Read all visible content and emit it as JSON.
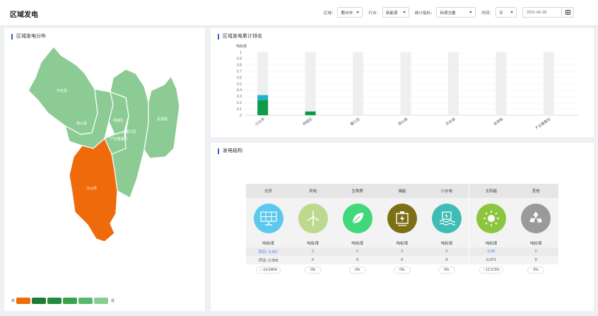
{
  "header": {
    "title": "区域发电",
    "filters": {
      "region_label": "区域：",
      "region_value": "衢州市",
      "industry_label": "行业：",
      "industry_value": "新能源",
      "metric_label": "统计指标：",
      "metric_value": "标煤当量",
      "time_label": "时间：",
      "time_unit_value": "日",
      "date_value": "2021-06-28"
    }
  },
  "map": {
    "title": "区域发电分布",
    "regions": [
      {
        "name": "开化县",
        "color": "#8ccc94"
      },
      {
        "name": "常山县",
        "color": "#8ccc94"
      },
      {
        "name": "柯城区",
        "color": "#8ccc94"
      },
      {
        "name": "衢江区",
        "color": "#8ccc94"
      },
      {
        "name": "产业集聚区",
        "color": "#8ccc94"
      },
      {
        "name": "龙游县",
        "color": "#8ccc94"
      },
      {
        "name": "江山市",
        "color": "#ef6a0b"
      }
    ],
    "legend": {
      "high": "高",
      "low": "低",
      "colors": [
        "#ef6a0b",
        "#1e7a35",
        "#248a3c",
        "#37a24c",
        "#5ab86e",
        "#8ccc94"
      ]
    }
  },
  "ranking": {
    "title": "区域发电累计排名",
    "chart_data": {
      "type": "bar",
      "ylabel": "吨标煤",
      "ylim": [
        0,
        1
      ],
      "yticks": [
        "1",
        "0.9",
        "0.8",
        "0.7",
        "0.6",
        "0.5",
        "0.4",
        "0.3",
        "0.2",
        "0.1",
        "0"
      ],
      "categories": [
        "江山市",
        "柯城区",
        "衢江区",
        "常山县",
        "开化县",
        "龙游县",
        "产业集聚区"
      ],
      "series": [
        {
          "color": "#0f9b48",
          "values": [
            0.24,
            0.06,
            0,
            0,
            0,
            0,
            0
          ]
        },
        {
          "color": "#1fb3c9",
          "values": [
            0.08,
            0,
            0,
            0,
            0,
            0,
            0
          ]
        }
      ],
      "background_bar": "#efefef",
      "grid": true
    }
  },
  "structure": {
    "title": "发电结构",
    "columns": [
      {
        "name": "光伏",
        "icon": "solar-panel-icon",
        "color": "#5bc8ee",
        "unit": "吨标煤",
        "yoy": "同日: 0.307",
        "mom": "环比: 0.358",
        "pct": "-14.346%",
        "trend": "down"
      },
      {
        "name": "风电",
        "icon": "wind-turbine-icon",
        "color": "#bcd98e",
        "unit": "吨标煤",
        "yoy": "0",
        "mom": "0",
        "pct": "0%",
        "trend": ""
      },
      {
        "name": "生物质",
        "icon": "leaf-icon",
        "color": "#41d87b",
        "unit": "吨标煤",
        "yoy": "0",
        "mom": "0",
        "pct": "0%",
        "trend": ""
      },
      {
        "name": "储能",
        "icon": "battery-storage-icon",
        "color": "#7d6f14",
        "unit": "吨标煤",
        "yoy": "0",
        "mom": "0",
        "pct": "0%",
        "trend": ""
      },
      {
        "name": "小水电",
        "icon": "hydro-power-icon",
        "color": "#3fbcb6",
        "unit": "吨标煤",
        "yoy": "0",
        "mom": "0",
        "pct": "0%",
        "trend": ""
      },
      {
        "name": "太阳能",
        "icon": "sun-icon",
        "color": "#8cc63f",
        "unit": "吨标煤",
        "yoy": "0.08",
        "mom": "0.071",
        "pct": "12.573%",
        "trend": "up"
      },
      {
        "name": "其他",
        "icon": "recycle-icon",
        "color": "#9a9a9a",
        "unit": "吨标煤",
        "yoy": "0",
        "mom": "0",
        "pct": "0%",
        "trend": ""
      }
    ]
  }
}
